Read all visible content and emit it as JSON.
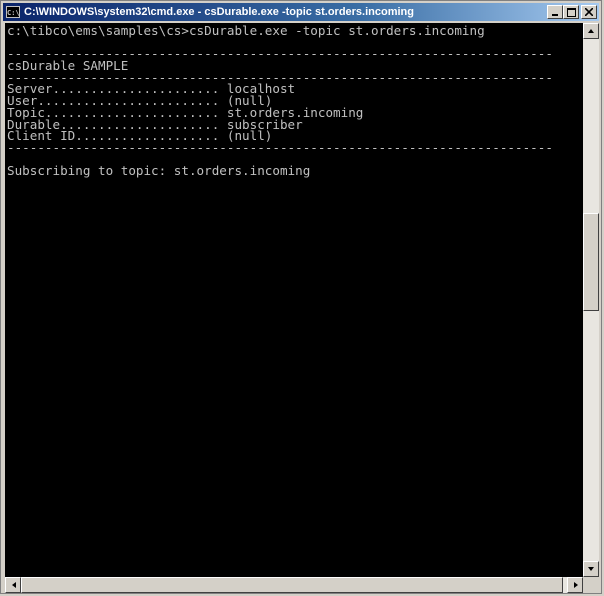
{
  "window": {
    "title": "C:\\WINDOWS\\system32\\cmd.exe - csDurable.exe -topic st.orders.incoming",
    "icon_label": "C:\\"
  },
  "console": {
    "lines": [
      "c:\\tibco\\ems\\samples\\cs>csDurable.exe -topic st.orders.incoming",
      "",
      "------------------------------------------------------------------------",
      "csDurable SAMPLE",
      "------------------------------------------------------------------------",
      "Server...................... localhost",
      "User........................ (null)",
      "Topic....................... st.orders.incoming",
      "Durable..................... subscriber",
      "Client ID................... (null)",
      "------------------------------------------------------------------------",
      "",
      "Subscribing to topic: st.orders.incoming"
    ]
  },
  "colors": {
    "title_active": "#0a246a",
    "console_bg": "#000000",
    "console_fg": "#c0c0c0"
  },
  "icons": [
    "cmd-icon",
    "minimize-icon",
    "maximize-icon",
    "close-icon",
    "scroll-up-icon",
    "scroll-down-icon",
    "scroll-left-icon",
    "scroll-right-icon"
  ]
}
